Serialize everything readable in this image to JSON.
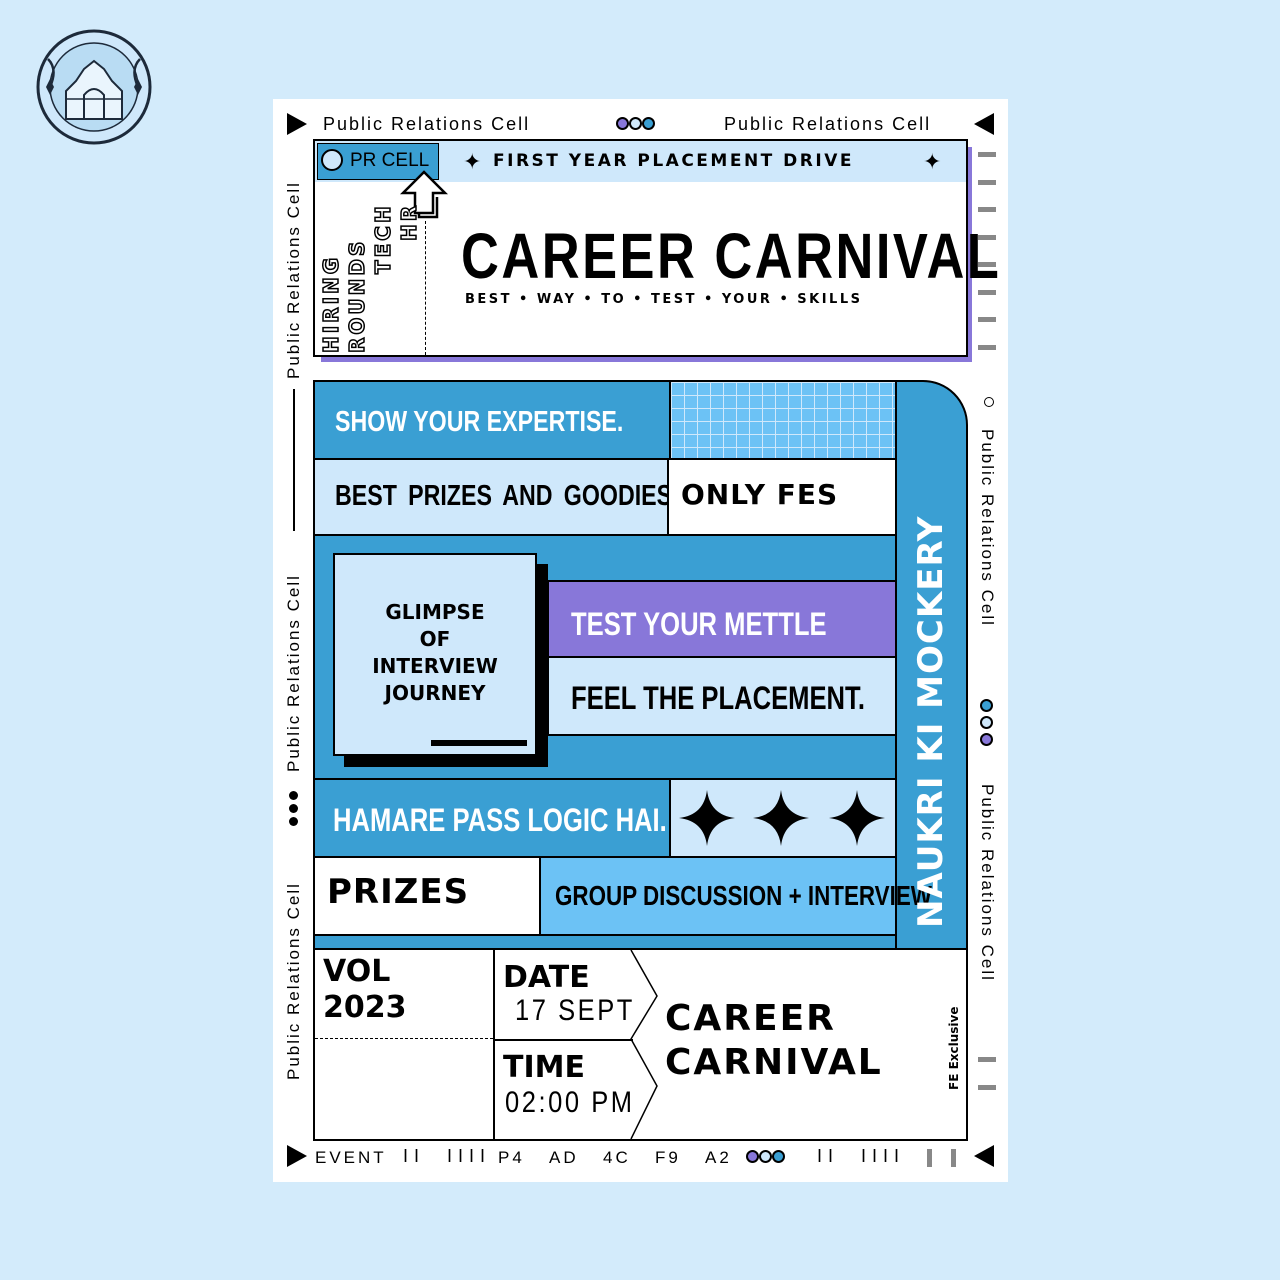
{
  "header": {
    "left_label": "Public Relations Cell",
    "right_label": "Public Relations Cell"
  },
  "side": {
    "left_top": "Public Relations Cell",
    "left_mid": "Public Relations Cell",
    "left_bottom": "Public Relations Cell",
    "right_top": "Public Relations Cell",
    "right_bottom": "Public Relations Cell"
  },
  "banner": {
    "badge": "PR CELL",
    "drive": "FIRST YEAR PLACEMENT DRIVE",
    "title": "CAREER CARNIVAL",
    "subtitle": "BEST • WAY • TO • TEST • YOUR • SKILLS",
    "rounds": [
      "HIRING",
      "ROUNDS",
      "TECH",
      "HR"
    ]
  },
  "main": {
    "expertise": "SHOW YOUR EXPERTISE.",
    "prizes_goodies": "BEST PRIZES AND GOODIES",
    "only_fes": "ONLY FES",
    "glimpse": [
      "GLIMPSE",
      "OF",
      "INTERVIEW",
      "JOURNEY"
    ],
    "mettle": "TEST YOUR METTLE",
    "feel": "FEEL THE PLACEMENT.",
    "logic": "HAMARE PASS LOGIC HAI.",
    "prizes": "PRIZES",
    "gd": "GROUP DISCUSSION + INTERVIEW",
    "vertical": "NAUKRI KI MOCKERY"
  },
  "info": {
    "vol_label": "VOL",
    "vol_year": "2023",
    "date_label": "DATE",
    "date_value": "17 SEPT",
    "time_label": "TIME",
    "time_value": "02:00 PM",
    "event_line1": "CAREER",
    "event_line2": "CARNIVAL",
    "fe_exclusive": "FE Exclusive"
  },
  "footer": {
    "event": "EVENT",
    "bars1": "II  IIII",
    "codes": [
      "P4",
      "AD",
      "4C",
      "F9",
      "A2"
    ],
    "bars2": "II  IIII"
  },
  "colors": {
    "background": "#d3ebfb",
    "blue": "#3a9fd3",
    "light_blue": "#cfe8fb",
    "sky": "#6cc2f5",
    "purple": "#8877d9",
    "dark_blue_dot": "#3a9fd3"
  },
  "icons": [
    "logo-emblem",
    "arrow-up-icon",
    "sparkle-icon",
    "triangle-icon"
  ]
}
